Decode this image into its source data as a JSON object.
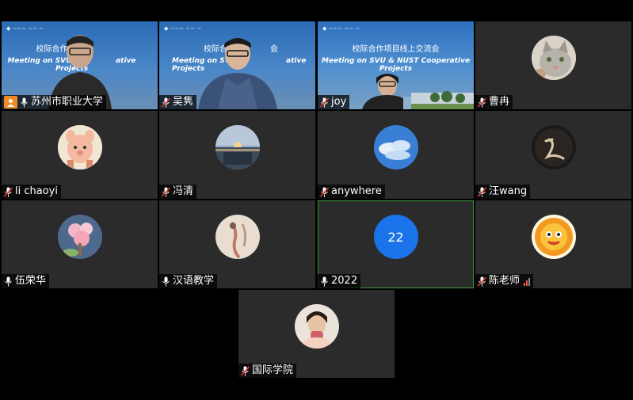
{
  "participants": [
    {
      "name": "苏州市职业大学",
      "host": true
    },
    {
      "name": "吴隽"
    },
    {
      "name": "joy"
    },
    {
      "name": "曹冉"
    },
    {
      "name": "li chaoyi"
    },
    {
      "name": "冯清"
    },
    {
      "name": "anywhere"
    },
    {
      "name": "汪wang"
    },
    {
      "name": "伍荣华"
    },
    {
      "name": "汉语教学"
    },
    {
      "name": "2022",
      "avatar_text": "22"
    },
    {
      "name": "陈老师"
    },
    {
      "name": "国际学院"
    }
  ],
  "slides": {
    "title_cn_1": "校际合作",
    "title_en_1": "Meeting on SVU & N",
    "title_en_1b": "ative Projects",
    "title_cn_2": "校际合作",
    "title_cn_2b": "会",
    "title_en_2": "Meeting on SVU &",
    "title_en_2b": "ative Projects",
    "title_cn_3": "校际合作项目线上交流会",
    "title_en_3": "Meeting on SVU & NUST Cooperative Projects"
  },
  "colors": {
    "tile_bg": "#2b2b2b",
    "active_border": "#3a9a3a",
    "host_badge": "#f08a24",
    "number_avatar": "#1a73e8"
  }
}
